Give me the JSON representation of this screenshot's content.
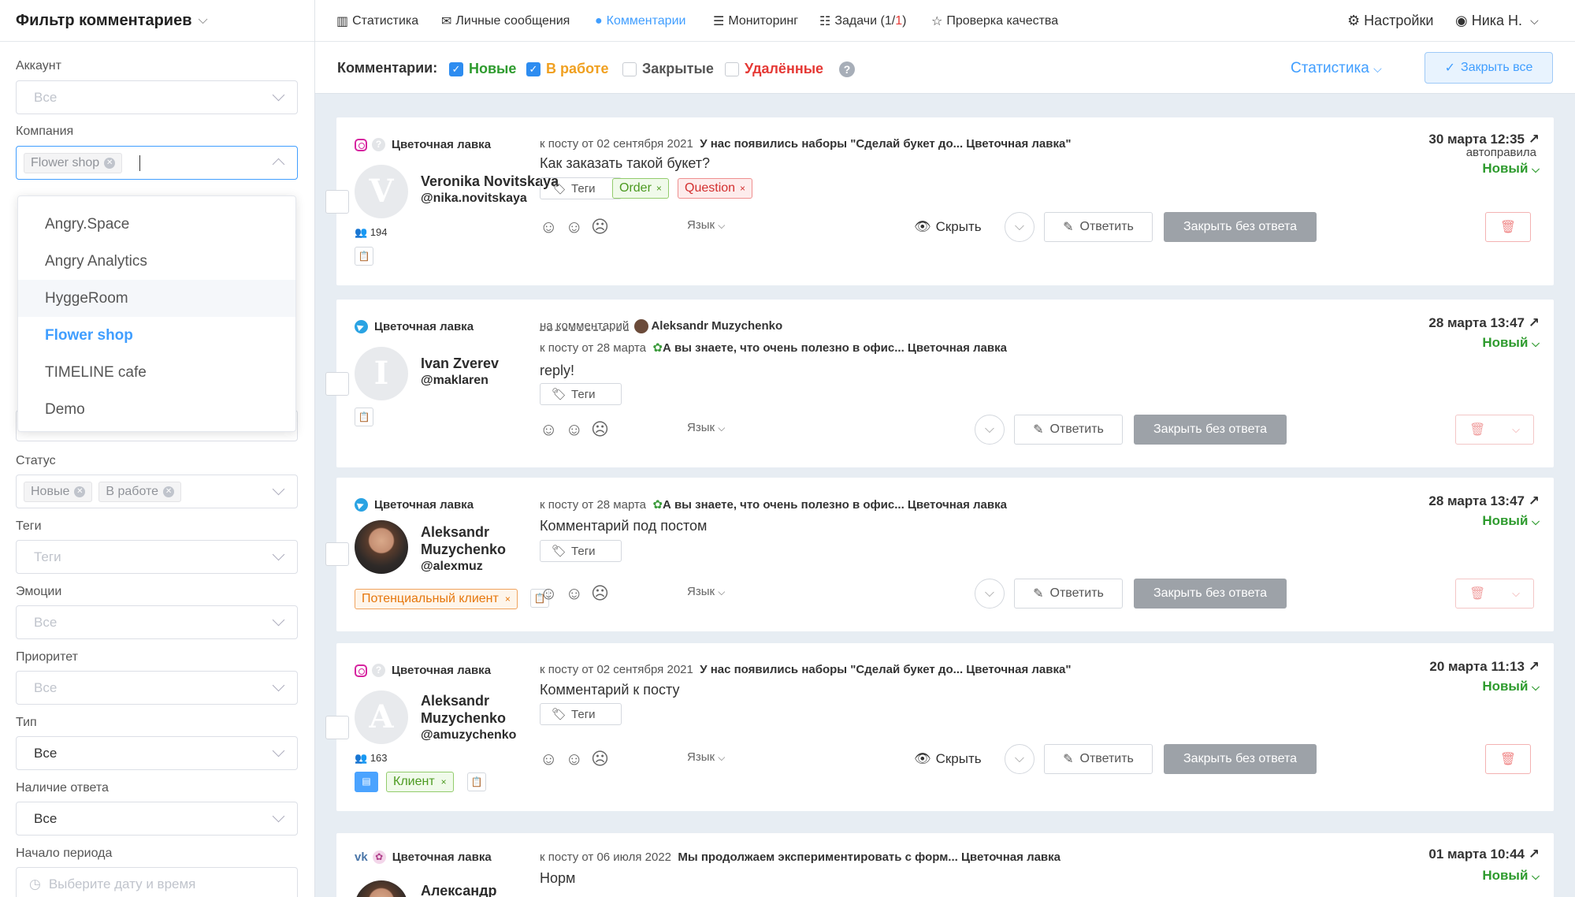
{
  "sidebar": {
    "title": "Фильтр комментариев",
    "account": {
      "label": "Аккаунт",
      "value": "Все"
    },
    "company": {
      "label": "Компания",
      "chip": "Flower shop",
      "options": [
        "Angry.Space",
        "Angry Analytics",
        "HyggeRoom",
        "Flower shop",
        "TIMELINE cafe",
        "Demo"
      ],
      "hovered": "HyggeRoom",
      "selected": "Flower shop"
    },
    "status": {
      "label": "Статус",
      "chips": [
        "Новые",
        "В работе"
      ]
    },
    "tags": {
      "label": "Теги",
      "placeholder": "Теги"
    },
    "emotions": {
      "label": "Эмоции",
      "placeholder": "Все"
    },
    "priority": {
      "label": "Приоритет",
      "placeholder": "Все"
    },
    "type": {
      "label": "Тип",
      "value": "Все"
    },
    "answer": {
      "label": "Наличие ответа",
      "value": "Все"
    },
    "period_start": {
      "label": "Начало периода",
      "placeholder": "Выберите дату и время"
    }
  },
  "nav": {
    "stats": "Статистика",
    "messages": "Личные сообщения",
    "comments": "Комментарии",
    "monitoring": "Мониторинг",
    "tasks": "Задачи",
    "tasks_count_a": "(1/",
    "tasks_count_b": "1",
    "tasks_count_c": ")",
    "quality": "Проверка качества",
    "settings": "Настройки",
    "user": "Ника Н."
  },
  "subbar": {
    "title": "Комментарии:",
    "new": "Новые",
    "in_work": "В работе",
    "closed": "Закрытые",
    "deleted": "Удалённые",
    "help": "?",
    "stats": "Статистика",
    "close_all": "Закрыть все"
  },
  "colors": {
    "accent": "#409eff",
    "new_status": "#2e9b2e",
    "in_work": "#f0a020",
    "deleted": "#e53935"
  },
  "common": {
    "tags": "Теги",
    "lang": "Язык",
    "hide": "Скрыть",
    "reply": "Ответить",
    "close_no_reply": "Закрыть без ответа",
    "status_new": "Новый",
    "on_comment": "на комментарий"
  },
  "cards": [
    {
      "source": "Цветочная лавка",
      "initial": "V",
      "name": "Veronika Novitskaya",
      "handle": "@nika.novitskaya",
      "followers": "194",
      "meta_prefix": "к посту от 02 сентября 2021",
      "meta_post": "У нас появились наборы \"Сделай букет до... Цветочная лавка\"",
      "text": "Как заказать такой букет?",
      "tag1": "Order",
      "tag2": "Question",
      "date": "30 марта 12:35",
      "rule": "автоправила"
    },
    {
      "source": "Цветочная лавка",
      "initial": "I",
      "name": "Ivan Zverev",
      "handle": "@maklaren",
      "reply_author": "Aleksandr Muzychenko",
      "meta_prefix": "к посту от 28 марта",
      "meta_post": "А вы знаете, что очень полезно в офис... Цветочная лавка",
      "text": "reply!",
      "date": "28 марта 13:47"
    },
    {
      "source": "Цветочная лавка",
      "name_line1": "Aleksandr",
      "name_line2": "Muzychenko",
      "handle": "@alexmuz",
      "label": "Потенциальный клиент",
      "meta_prefix": "к посту от 28 марта",
      "meta_post": "А вы знаете, что очень полезно в офис... Цветочная лавка",
      "text": "Комментарий под постом",
      "date": "28 марта 13:47"
    },
    {
      "source": "Цветочная лавка",
      "initial": "A",
      "name_line1": "Aleksandr",
      "name_line2": "Muzychenko",
      "handle": "@amuzychenko",
      "followers": "163",
      "label": "Клиент",
      "meta_prefix": "к посту от 02 сентября 2021",
      "meta_post": "У нас появились наборы \"Сделай букет до... Цветочная лавка\"",
      "text": "Комментарий к посту",
      "date": "20 марта 11:13"
    },
    {
      "source": "Цветочная лавка",
      "name_line1": "Александр",
      "meta_prefix": "к посту от 06 июля 2022",
      "meta_post": "Мы продолжаем экспериментировать с форм... Цветочная лавка",
      "text": "Норм",
      "date": "01 марта 10:44"
    }
  ]
}
